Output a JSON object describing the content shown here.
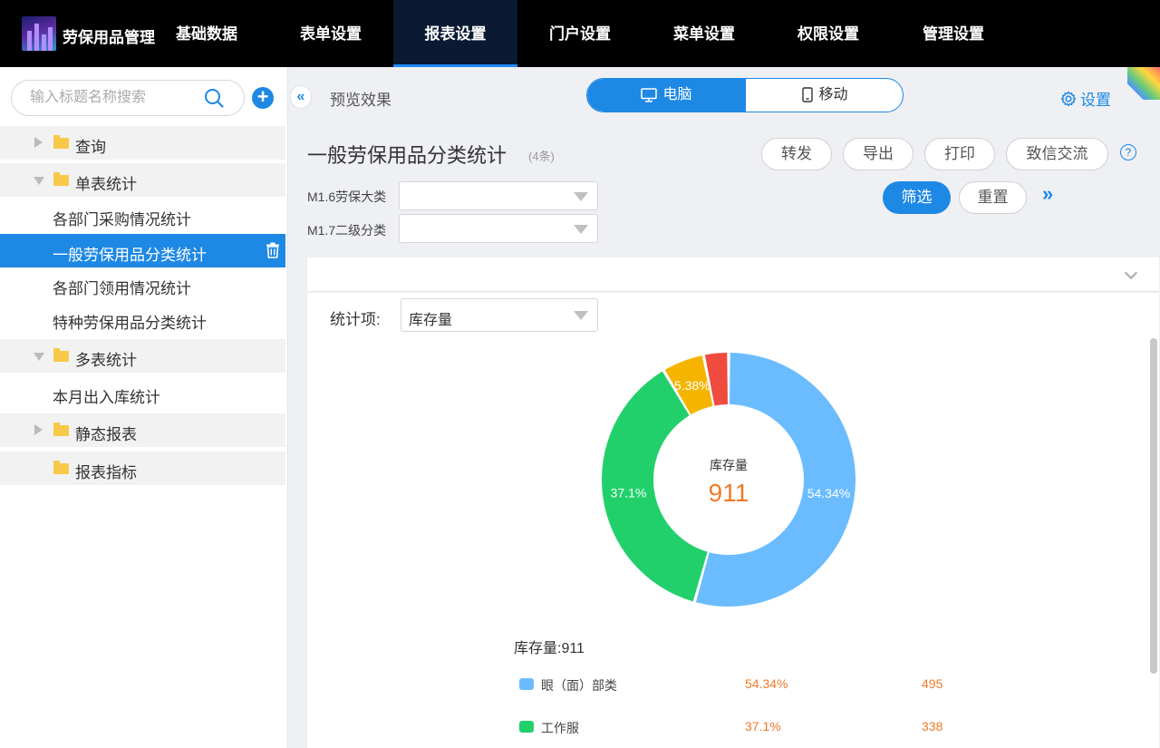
{
  "app": {
    "title": "劳保用品管理"
  },
  "nav": [
    {
      "label": "基础数据"
    },
    {
      "label": "表单设置"
    },
    {
      "label": "报表设置"
    },
    {
      "label": "门户设置"
    },
    {
      "label": "菜单设置"
    },
    {
      "label": "权限设置"
    },
    {
      "label": "管理设置"
    }
  ],
  "sidebar": {
    "search_placeholder": "输入标题名称搜索",
    "groups": [
      {
        "label": "查询"
      },
      {
        "label": "单表统计"
      },
      {
        "label": "多表统计"
      },
      {
        "label": "静态报表"
      },
      {
        "label": "报表指标"
      }
    ],
    "items": [
      {
        "label": "各部门采购情况统计"
      },
      {
        "label": "一般劳保用品分类统计"
      },
      {
        "label": "各部门领用情况统计"
      },
      {
        "label": "特种劳保用品分类统计"
      },
      {
        "label": "本月出入库统计"
      }
    ]
  },
  "toolbar": {
    "preview_label": "预览效果",
    "device_desktop": "电脑",
    "device_mobile": "移动",
    "settings_label": "设置"
  },
  "report": {
    "title": "一般劳保用品分类统计",
    "count": "(4条)",
    "actions": {
      "forward": "转发",
      "export": "导出",
      "print": "打印",
      "chat": "致信交流"
    },
    "filters": [
      {
        "label": "M1.6劳保大类",
        "value": ""
      },
      {
        "label": "M1.7二级分类",
        "value": ""
      }
    ],
    "filter_button": "筛选",
    "reset_button": "重置",
    "stat_label": "统计项:",
    "stat_value": "库存量"
  },
  "chart_data": {
    "type": "pie",
    "center_label": "库存量",
    "total": 911,
    "legend_title": "库存量:911",
    "slices": [
      {
        "name": "眼（面）部类",
        "percent": 54.34,
        "value": 495,
        "color": "#6bbcff",
        "label": "54.34%"
      },
      {
        "name": "工作服",
        "percent": 37.1,
        "value": 338,
        "color": "#22d06b",
        "label": "37.1%"
      },
      {
        "name": "",
        "percent": 5.38,
        "value": null,
        "color": "#f5b400",
        "label": "5.38%"
      },
      {
        "name": "",
        "percent": 3.18,
        "value": null,
        "color": "#ef4b3f",
        "label": ""
      }
    ]
  },
  "legend": {
    "title": "库存量:911",
    "rows": [
      {
        "name": "眼（面）部类",
        "pct": "54.34%",
        "num": "495",
        "color": "#6bbcff"
      },
      {
        "name": "工作服",
        "pct": "37.1%",
        "num": "338",
        "color": "#22d06b"
      }
    ]
  }
}
